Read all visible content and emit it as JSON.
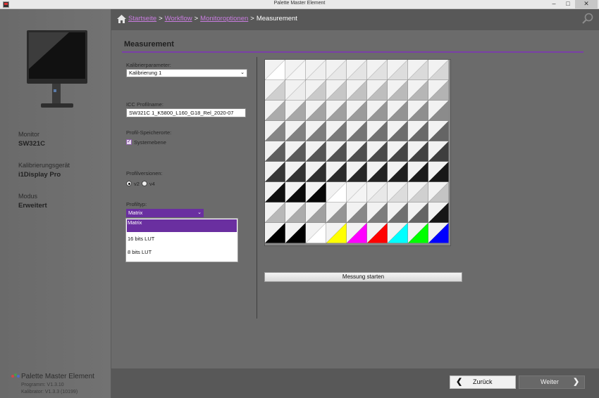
{
  "window": {
    "title": "Palette Master Element",
    "minimize": "–",
    "maximize": "□",
    "close": "✕"
  },
  "sidebar": {
    "monitor_label": "Monitor",
    "monitor_value": "SW321C",
    "calibrator_label": "Kalibrierungsgerät",
    "calibrator_value": "i1Display Pro",
    "mode_label": "Modus",
    "mode_value": "Erweitert",
    "brand": "Palette Master Element",
    "program_version": "Programm: V1.3.10",
    "calibrator_version": "Kalibrator: V1.3.3 (10199)"
  },
  "breadcrumb": {
    "home": "Startseite",
    "workflow": "Workflow",
    "options": "Monitoroptionen",
    "current": "Measurement",
    "separator": ">"
  },
  "main": {
    "title": "Measurement",
    "kalib_label": "Kalibrierparameter:",
    "kalib_value": "Kalibrierung 1",
    "icc_label": "ICC Profilname:",
    "icc_value": "SW321C 1_K5800_L160_G18_Rel_2020-07",
    "storage_label": "Profil-Speicherorte:",
    "storage_option": "Systemebene",
    "storage_checked": true,
    "version_label": "Profilversionen:",
    "version_v2": "v2",
    "version_v4": "v4",
    "version_selected": "v2",
    "type_label": "Profiltyp:",
    "type_value": "Matrix",
    "type_options": [
      "Matrix",
      "16 bits LUT",
      "8 bits LUT"
    ],
    "start_button": "Messung starten"
  },
  "patch_colors": {
    "rows": [
      [
        "#ffffff",
        "#f5f5f5",
        "#eeeeee",
        "#e8e8e8",
        "#e4e4e4",
        "#e1e1e1",
        "#dddddd",
        "#dadada",
        "#d6d6d6"
      ],
      [
        "#cfcfcf",
        "#ececec",
        "#cacaca",
        "#c6c6c6",
        "#c2c2c2",
        "#bebebe",
        "#bababa",
        "#b6b6b6",
        "#b3b3b3"
      ],
      [
        "#ababab",
        "#a7a7a7",
        "#a3a3a3",
        "#9f9f9f",
        "#9b9b9b",
        "#979797",
        "#939393",
        "#8f8f8f",
        "#8b8b8b"
      ],
      [
        "#858585",
        "#818181",
        "#7d7d7d",
        "#797979",
        "#757575",
        "#717171",
        "#6d6d6d",
        "#696969",
        "#656565"
      ],
      [
        "#5e5e5e",
        "#5a5a5a",
        "#565656",
        "#525252",
        "#4e4e4e",
        "#4a4a4a",
        "#464646",
        "#424242",
        "#3e3e3e"
      ],
      [
        "#373737",
        "#333333",
        "#2f2f2f",
        "#2b2b2b",
        "#272727",
        "#232323",
        "#1f1f1f",
        "#1b1b1b",
        "#171717"
      ],
      [
        "#0f0f0f",
        "#0b0b0b",
        "#070707",
        "#ffffff",
        "#f4f4f4",
        "#e8e8e8",
        "#dcdcdc",
        "#d0d0d0",
        "#c4c4c4"
      ],
      [
        "#b8b8b8",
        "#acacac",
        "#a0a0a0",
        "#949494",
        "#888888",
        "#7c7c7c",
        "#707070",
        "#646464",
        "#161616"
      ],
      [
        "#000000",
        "#000000",
        "#ffffff",
        "#ffff00",
        "#ff00ff",
        "#ff0000",
        "#00ffff",
        "#00ff00",
        "#0000ff"
      ]
    ]
  },
  "footer": {
    "back_arrow": "❮",
    "back_label": "Zurück",
    "next_label": "Weiter",
    "next_arrow": "❯"
  },
  "colors": {
    "accent": "#6a2fa0",
    "link": "#c97ce0"
  }
}
